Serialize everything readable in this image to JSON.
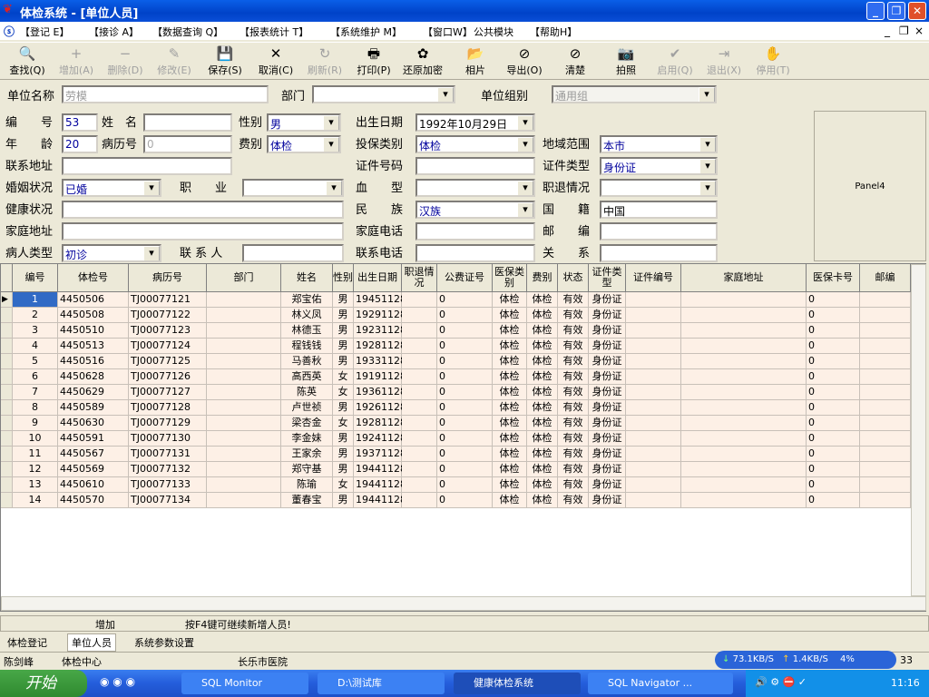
{
  "window": {
    "title": "体检系统 - [单位人员]"
  },
  "menu": [
    "【登记 E】",
    "【接诊 A】",
    "【数据查询 Q】",
    "【报表统计 T】",
    "【系统维护 M】",
    "【窗口W】",
    "公共模块",
    "【帮助H】"
  ],
  "toolbar": [
    {
      "label": "查找(Q)",
      "icon": "search-icon",
      "glyph": "🔍",
      "enabled": true
    },
    {
      "label": "增加(A)",
      "icon": "add-icon",
      "glyph": "+",
      "enabled": false
    },
    {
      "label": "删除(D)",
      "icon": "delete-icon",
      "glyph": "−",
      "enabled": false
    },
    {
      "label": "修改(E)",
      "icon": "edit-icon",
      "glyph": "✎",
      "enabled": false
    },
    {
      "label": "保存(S)",
      "icon": "save-icon",
      "glyph": "💾",
      "enabled": true
    },
    {
      "label": "取消(C)",
      "icon": "cancel-icon",
      "glyph": "✕",
      "enabled": true
    },
    {
      "label": "刷新(R)",
      "icon": "refresh-icon",
      "glyph": "↻",
      "enabled": false
    },
    {
      "label": "打印(P)",
      "icon": "printer-icon",
      "glyph": "🖶",
      "enabled": true
    },
    {
      "label": "还原加密",
      "icon": "decrypt-icon",
      "glyph": "✿",
      "enabled": true
    },
    {
      "label": "相片",
      "icon": "folder-icon",
      "glyph": "📂",
      "enabled": true
    },
    {
      "label": "导出(O)",
      "icon": "export-icon",
      "glyph": "⊘",
      "enabled": true
    },
    {
      "label": "清楚",
      "icon": "clear-icon",
      "glyph": "⊘",
      "enabled": true
    },
    {
      "label": "拍照",
      "icon": "camera-icon",
      "glyph": "📷",
      "enabled": true
    },
    {
      "label": "启用(Q)",
      "icon": "check-icon",
      "glyph": "✔",
      "enabled": false
    },
    {
      "label": "退出(X)",
      "icon": "exit-icon",
      "glyph": "⇥",
      "enabled": false
    },
    {
      "label": "停用(T)",
      "icon": "stop-icon",
      "glyph": "✋",
      "enabled": false
    }
  ],
  "unit": {
    "unit_label": "单位名称",
    "unit_value": "劳模",
    "dept_label": "部门",
    "dept_value": "",
    "group_label": "单位组别",
    "group_value": "通用组"
  },
  "form": {
    "id_label": "编　　号",
    "id": "53",
    "name_label": "姓　名",
    "name": "",
    "sex_label": "性别",
    "sex": "男",
    "birth_label": "出生日期",
    "birth": "1992年10月29日",
    "age_label": "年　　龄",
    "age": "20",
    "record_label": "病历号",
    "record": "0",
    "fee_label": "费别",
    "fee": "体检",
    "insure_label": "投保类别",
    "insure": "体检",
    "region_label": "地域范围",
    "region": "本市",
    "addr_label": "联系地址",
    "addr": "",
    "cert_no_label": "证件号码",
    "cert_no": "",
    "cert_type_label": "证件类型",
    "cert_type": "身份证",
    "marriage_label": "婚姻状况",
    "marriage": "已婚",
    "job_label": "职　　业",
    "job": "",
    "blood_label": "血　　型",
    "blood": "",
    "retire_label": "职退情况",
    "retire": "",
    "health_label": "健康状况",
    "health": "",
    "ethnic_label": "民　　族",
    "ethnic": "汉族",
    "nation_label": "国　　籍",
    "nation": "中国",
    "home_label": "家庭地址",
    "home": "",
    "home_tel_label": "家庭电话",
    "home_tel": "",
    "zip_label": "邮　　编",
    "zip": "",
    "ptype_label": "病人类型",
    "ptype": "初诊",
    "contact_label": "联 系 人",
    "contact": "",
    "contact_tel_label": "联系电话",
    "contact_tel": "",
    "relation_label": "关　　系",
    "relation": "",
    "panel_label": "Panel4"
  },
  "grid": {
    "columns": [
      "编号",
      "体检号",
      "病历号",
      "部门",
      "姓名",
      "性别",
      "出生日期",
      "职退情况",
      "公费证号",
      "医保类别",
      "费别",
      "状态",
      "证件类型",
      "证件编号",
      "家庭地址",
      "医保卡号",
      "邮编"
    ],
    "rows": [
      [
        "1",
        "4450506",
        "TJ00077121",
        "",
        "郑宝佑",
        "男",
        "19451128",
        "",
        "0",
        "体检",
        "体检",
        "有效",
        "身份证",
        "",
        "",
        "0",
        ""
      ],
      [
        "2",
        "4450508",
        "TJ00077122",
        "",
        "林义凤",
        "男",
        "19291128",
        "",
        "0",
        "体检",
        "体检",
        "有效",
        "身份证",
        "",
        "",
        "0",
        ""
      ],
      [
        "3",
        "4450510",
        "TJ00077123",
        "",
        "林德玉",
        "男",
        "19231128",
        "",
        "0",
        "体检",
        "体检",
        "有效",
        "身份证",
        "",
        "",
        "0",
        ""
      ],
      [
        "4",
        "4450513",
        "TJ00077124",
        "",
        "程钱钱",
        "男",
        "19281128",
        "",
        "0",
        "体检",
        "体检",
        "有效",
        "身份证",
        "",
        "",
        "0",
        ""
      ],
      [
        "5",
        "4450516",
        "TJ00077125",
        "",
        "马善秋",
        "男",
        "19331128",
        "",
        "0",
        "体检",
        "体检",
        "有效",
        "身份证",
        "",
        "",
        "0",
        ""
      ],
      [
        "6",
        "4450628",
        "TJ00077126",
        "",
        "高西英",
        "女",
        "19191128",
        "",
        "0",
        "体检",
        "体检",
        "有效",
        "身份证",
        "",
        "",
        "0",
        ""
      ],
      [
        "7",
        "4450629",
        "TJ00077127",
        "",
        "陈英",
        "女",
        "19361128",
        "",
        "0",
        "体检",
        "体检",
        "有效",
        "身份证",
        "",
        "",
        "0",
        ""
      ],
      [
        "8",
        "4450589",
        "TJ00077128",
        "",
        "卢世祯",
        "男",
        "19261128",
        "",
        "0",
        "体检",
        "体检",
        "有效",
        "身份证",
        "",
        "",
        "0",
        ""
      ],
      [
        "9",
        "4450630",
        "TJ00077129",
        "",
        "梁杏金",
        "女",
        "19281128",
        "",
        "0",
        "体检",
        "体检",
        "有效",
        "身份证",
        "",
        "",
        "0",
        ""
      ],
      [
        "10",
        "4450591",
        "TJ00077130",
        "",
        "李金妹",
        "男",
        "19241128",
        "",
        "0",
        "体检",
        "体检",
        "有效",
        "身份证",
        "",
        "",
        "0",
        ""
      ],
      [
        "11",
        "4450567",
        "TJ00077131",
        "",
        "王家余",
        "男",
        "19371128",
        "",
        "0",
        "体检",
        "体检",
        "有效",
        "身份证",
        "",
        "",
        "0",
        ""
      ],
      [
        "12",
        "4450569",
        "TJ00077132",
        "",
        "郑守基",
        "男",
        "19441128",
        "",
        "0",
        "体检",
        "体检",
        "有效",
        "身份证",
        "",
        "",
        "0",
        ""
      ],
      [
        "13",
        "4450610",
        "TJ00077133",
        "",
        "陈瑜",
        "女",
        "19441128",
        "",
        "0",
        "体检",
        "体检",
        "有效",
        "身份证",
        "",
        "",
        "0",
        ""
      ],
      [
        "14",
        "4450570",
        "TJ00077134",
        "",
        "董春宝",
        "男",
        "19441128",
        "",
        "0",
        "体检",
        "体检",
        "有效",
        "身份证",
        "",
        "",
        "0",
        ""
      ]
    ]
  },
  "status": {
    "mode": "增加",
    "message": "按F4键可继续新增人员!"
  },
  "tabs": [
    "体检登记",
    "单位人员",
    "系统参数设置"
  ],
  "bottom": {
    "user": "陈剑峰",
    "center": "体检中心",
    "extra": "",
    "hospital": "长乐市医院",
    "net_down": "73.1KB/S",
    "net_up": "1.4KB/S",
    "cpu": "4%",
    "num": "33"
  },
  "taskbar": {
    "start": "开始",
    "tasks": [
      "SQL Monitor",
      "D:\\测试库",
      "健康体检系统",
      "SQL Navigator ..."
    ],
    "clock": "11:16"
  }
}
